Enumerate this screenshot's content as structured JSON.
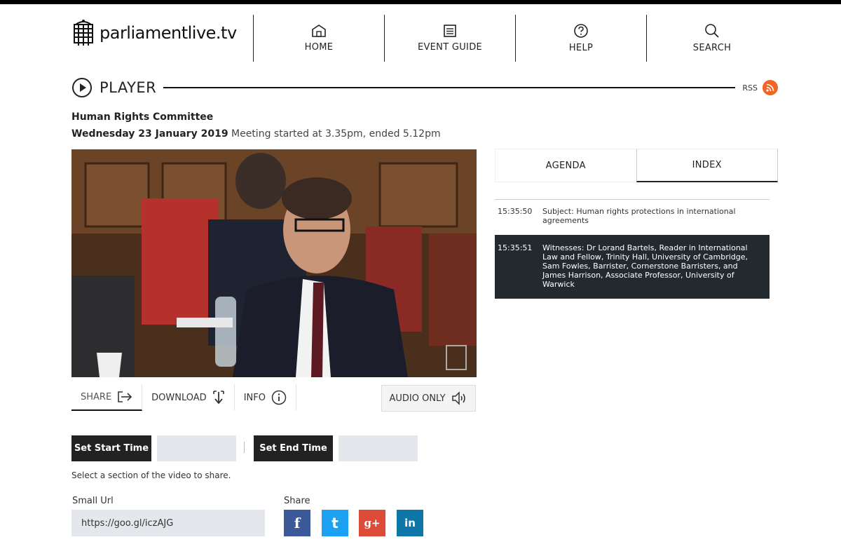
{
  "site": {
    "name": "parliamentlive.tv"
  },
  "nav": {
    "home": "HOME",
    "event_guide": "EVENT GUIDE",
    "help": "HELP",
    "search": "SEARCH"
  },
  "player": {
    "title": "PLAYER",
    "rss": "RSS"
  },
  "meeting": {
    "committee": "Human Rights Committee",
    "date": "Wednesday 23 January 2019",
    "times": "Meeting started at 3.35pm, ended 5.12pm"
  },
  "video_tabs": {
    "share": "SHARE",
    "download": "DOWNLOAD",
    "info": "INFO",
    "audio_only": "AUDIO ONLY"
  },
  "share_panel": {
    "set_start": "Set Start Time",
    "set_end": "Set End Time",
    "start_value": "",
    "end_value": "",
    "hint": "Select a section of the video to share.",
    "small_url_label": "Small Url",
    "small_url": "https://goo.gl/iczAJG",
    "share_label": "Share",
    "social": {
      "facebook": "f",
      "twitter": "t",
      "googleplus": "g+",
      "linkedin": "in"
    }
  },
  "right_tabs": {
    "agenda": "AGENDA",
    "index": "INDEX"
  },
  "index_entries": [
    {
      "time": "15:35:50",
      "text": "Subject: Human rights protections in international agreements"
    },
    {
      "time": "15:35:51",
      "text": "Witnesses: Dr Lorand Bartels, Reader in International Law and Fellow, Trinity Hall, University of Cambridge, Sam Fowles, Barrister, Cornerstone Barristers, and James Harrison, Associate Professor, University of Warwick"
    }
  ],
  "colors": {
    "rss": "#f26522",
    "facebook": "#3b5998",
    "twitter": "#1da1f2",
    "googleplus": "#dd4b39",
    "linkedin": "#0e76a8",
    "dark_button": "#222222",
    "selected_row": "#232a2f"
  },
  "icons": [
    "portcullis-logo-icon",
    "home-icon",
    "event-guide-icon",
    "help-icon",
    "search-icon",
    "play-circle-icon",
    "rss-icon",
    "share-arrow-icon",
    "download-icon",
    "info-icon",
    "audio-speaker-icon"
  ]
}
